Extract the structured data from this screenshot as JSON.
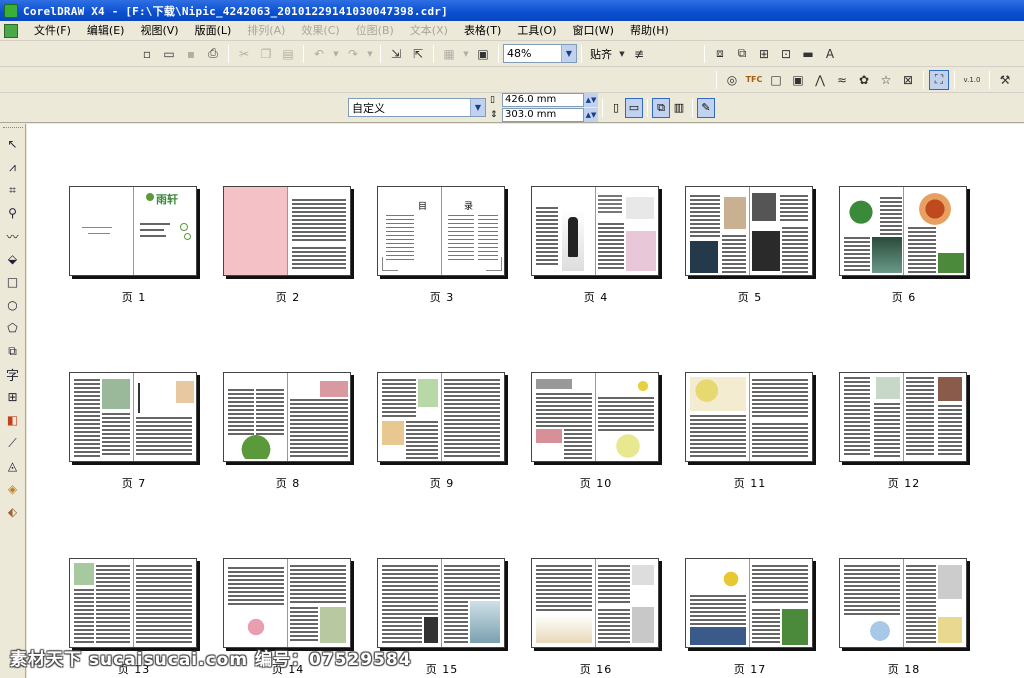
{
  "window": {
    "title": "CorelDRAW X4 - [F:\\下载\\Nipic_4242063_20101229141030047398.cdr]"
  },
  "menu": {
    "items": [
      {
        "label": "文件(F)",
        "enabled": true
      },
      {
        "label": "编辑(E)",
        "enabled": true
      },
      {
        "label": "视图(V)",
        "enabled": true
      },
      {
        "label": "版面(L)",
        "enabled": true
      },
      {
        "label": "排列(A)",
        "enabled": false
      },
      {
        "label": "效果(C)",
        "enabled": false
      },
      {
        "label": "位图(B)",
        "enabled": false
      },
      {
        "label": "文本(X)",
        "enabled": false
      },
      {
        "label": "表格(T)",
        "enabled": true
      },
      {
        "label": "工具(O)",
        "enabled": true
      },
      {
        "label": "窗口(W)",
        "enabled": true
      },
      {
        "label": "帮助(H)",
        "enabled": true
      }
    ]
  },
  "toolbar": {
    "zoom_value": "48%",
    "snap_label": "贴齐",
    "version_label": "v.1.0"
  },
  "propertybar": {
    "paper_preset": "自定义",
    "width_value": "426.0 mm",
    "height_value": "303.0 mm"
  },
  "pages": [
    {
      "label": "页 1"
    },
    {
      "label": "页 2"
    },
    {
      "label": "页 3"
    },
    {
      "label": "页 4"
    },
    {
      "label": "页 5"
    },
    {
      "label": "页 6"
    },
    {
      "label": "页 7"
    },
    {
      "label": "页 8"
    },
    {
      "label": "页 9"
    },
    {
      "label": "页 10"
    },
    {
      "label": "页 11"
    },
    {
      "label": "页 12"
    },
    {
      "label": "页 13"
    },
    {
      "label": "页 14"
    },
    {
      "label": "页 15"
    },
    {
      "label": "页 16"
    },
    {
      "label": "页 17"
    },
    {
      "label": "页 18"
    }
  ],
  "thumb_text": {
    "p1_logo": "雨轩",
    "p3_left": "目",
    "p3_right": "录"
  },
  "watermark": {
    "text": "素材天下 sucaisucai.com  编号：07529584"
  },
  "colors": {
    "titlebar": "#0a4fd0",
    "canvas": "#ffffff",
    "chrome": "#ece9d8",
    "pink_page": "#f4c2c6"
  }
}
